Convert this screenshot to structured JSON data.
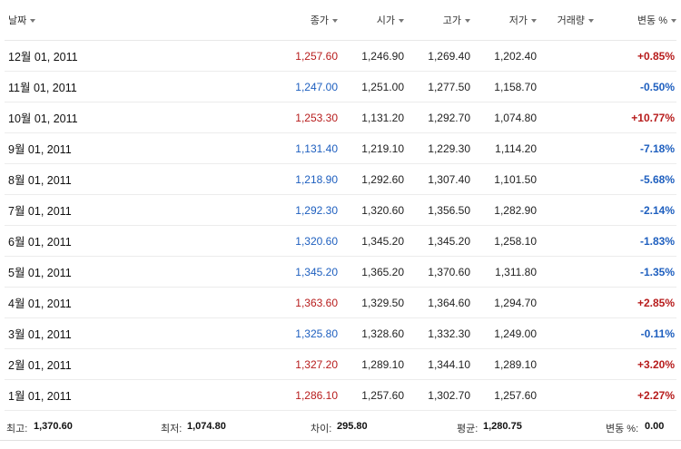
{
  "columns": {
    "date": "날짜",
    "close": "종가",
    "open": "시가",
    "high": "고가",
    "low": "저가",
    "volume": "거래량",
    "change": "변동 %"
  },
  "rows": [
    {
      "date": "12월 01, 2011",
      "close": "1,257.60",
      "open": "1,246.90",
      "high": "1,269.40",
      "low": "1,202.40",
      "volume": "",
      "change": "+0.85%",
      "dir": "up"
    },
    {
      "date": "11월 01, 2011",
      "close": "1,247.00",
      "open": "1,251.00",
      "high": "1,277.50",
      "low": "1,158.70",
      "volume": "",
      "change": "-0.50%",
      "dir": "down"
    },
    {
      "date": "10월 01, 2011",
      "close": "1,253.30",
      "open": "1,131.20",
      "high": "1,292.70",
      "low": "1,074.80",
      "volume": "",
      "change": "+10.77%",
      "dir": "up"
    },
    {
      "date": "9월 01, 2011",
      "close": "1,131.40",
      "open": "1,219.10",
      "high": "1,229.30",
      "low": "1,114.20",
      "volume": "",
      "change": "-7.18%",
      "dir": "down"
    },
    {
      "date": "8월 01, 2011",
      "close": "1,218.90",
      "open": "1,292.60",
      "high": "1,307.40",
      "low": "1,101.50",
      "volume": "",
      "change": "-5.68%",
      "dir": "down"
    },
    {
      "date": "7월 01, 2011",
      "close": "1,292.30",
      "open": "1,320.60",
      "high": "1,356.50",
      "low": "1,282.90",
      "volume": "",
      "change": "-2.14%",
      "dir": "down"
    },
    {
      "date": "6월 01, 2011",
      "close": "1,320.60",
      "open": "1,345.20",
      "high": "1,345.20",
      "low": "1,258.10",
      "volume": "",
      "change": "-1.83%",
      "dir": "down"
    },
    {
      "date": "5월 01, 2011",
      "close": "1,345.20",
      "open": "1,365.20",
      "high": "1,370.60",
      "low": "1,311.80",
      "volume": "",
      "change": "-1.35%",
      "dir": "down"
    },
    {
      "date": "4월 01, 2011",
      "close": "1,363.60",
      "open": "1,329.50",
      "high": "1,364.60",
      "low": "1,294.70",
      "volume": "",
      "change": "+2.85%",
      "dir": "up"
    },
    {
      "date": "3월 01, 2011",
      "close": "1,325.80",
      "open": "1,328.60",
      "high": "1,332.30",
      "low": "1,249.00",
      "volume": "",
      "change": "-0.11%",
      "dir": "down"
    },
    {
      "date": "2월 01, 2011",
      "close": "1,327.20",
      "open": "1,289.10",
      "high": "1,344.10",
      "low": "1,289.10",
      "volume": "",
      "change": "+3.20%",
      "dir": "up"
    },
    {
      "date": "1월 01, 2011",
      "close": "1,286.10",
      "open": "1,257.60",
      "high": "1,302.70",
      "low": "1,257.60",
      "volume": "",
      "change": "+2.27%",
      "dir": "up"
    }
  ],
  "summary": {
    "high_label": "최고:",
    "high_value": "1,370.60",
    "low_label": "최저:",
    "low_value": "1,074.80",
    "diff_label": "차이:",
    "diff_value": "295.80",
    "avg_label": "평균:",
    "avg_value": "1,280.75",
    "change_label": "변동 %:",
    "change_value": "0.00"
  },
  "colors": {
    "up": "#b71c1c",
    "down": "#1e5fbf"
  },
  "icons": {
    "sort": "caret-down-icon"
  }
}
